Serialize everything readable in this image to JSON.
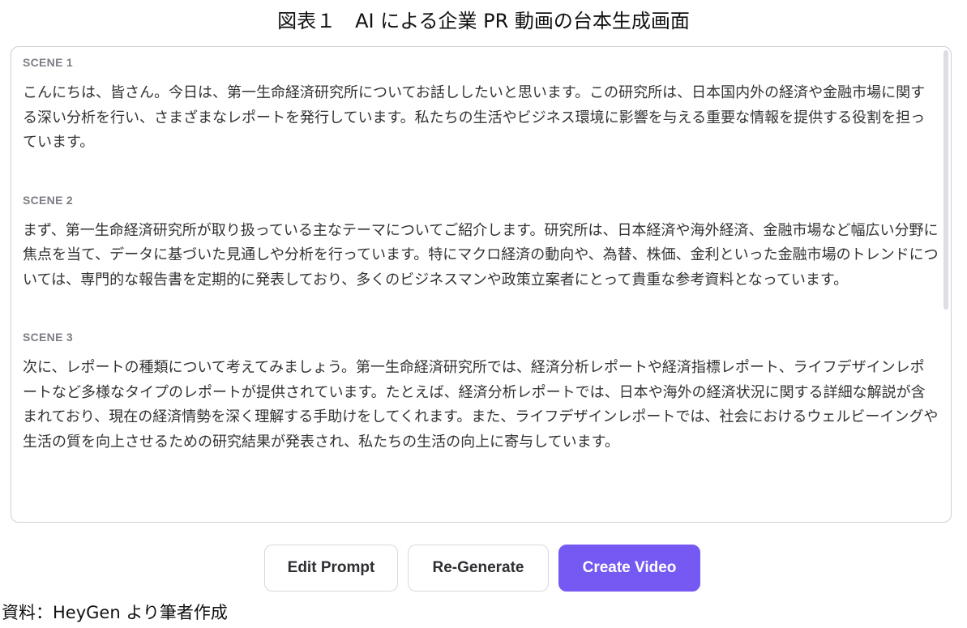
{
  "figure_title": "図表１　AI による企業 PR 動画の台本生成画面",
  "script_panel": {
    "scenes": [
      {
        "label": "SCENE 1",
        "text": "こんにちは、皆さん。今日は、第一生命経済研究所についてお話ししたいと思います。この研究所は、日本国内外の経済や金融市場に関する深い分析を行い、さまざまなレポートを発行しています。私たちの生活やビジネス環境に影響を与える重要な情報を提供する役割を担っています。"
      },
      {
        "label": "SCENE 2",
        "text": "まず、第一生命経済研究所が取り扱っている主なテーマについてご紹介します。研究所は、日本経済や海外経済、金融市場など幅広い分野に焦点を当て、データに基づいた見通しや分析を行っています。特にマクロ経済の動向や、為替、株価、金利といった金融市場のトレンドについては、専門的な報告書を定期的に発表しており、多くのビジネスマンや政策立案者にとって貴重な参考資料となっています。"
      },
      {
        "label": "SCENE 3",
        "text": "次に、レポートの種類について考えてみましょう。第一生命経済研究所では、経済分析レポートや経済指標レポート、ライフデザインレポートなど多様なタイプのレポートが提供されています。たとえば、経済分析レポートでは、日本や海外の経済状況に関する詳細な解説が含まれており、現在の経済情勢を深く理解する手助けをしてくれます。また、ライフデザインレポートでは、社会におけるウェルビーイングや生活の質を向上させるための研究結果が発表され、私たちの生活の向上に寄与しています。"
      }
    ]
  },
  "buttons": {
    "edit_prompt": "Edit Prompt",
    "regenerate": "Re-Generate",
    "create_video": "Create Video"
  },
  "source_note": "資料：HeyGen より筆者作成",
  "colors": {
    "primary": "#7559f2",
    "scene_label": "#7d7d86",
    "panel_border": "#cfcfd6"
  }
}
